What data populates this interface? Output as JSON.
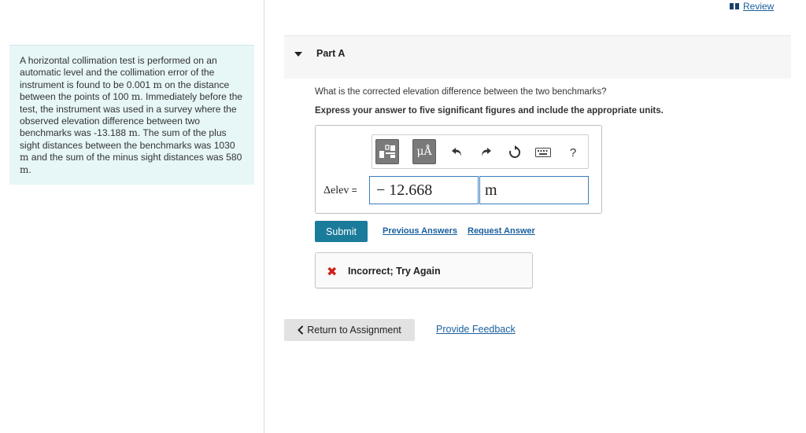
{
  "header": {
    "review_label": "Review"
  },
  "problem": {
    "s1": "A horizontal collimation test is performed on an automatic level and the collimation error of the instrument is found to be 0.001",
    "u1": "m",
    "s2": "on the distance between the points of 100",
    "u2": "m",
    "s3": ". Immediately before the test, the instrument was used in a survey where the observed elevation difference between two benchmarks was -13.188",
    "u3": "m",
    "s4": ". The sum of the plus sight distances between the benchmarks was 1030",
    "u4": "m",
    "s5": "and the sum of the minus sight distances was 580",
    "u5": "m",
    "s6": "."
  },
  "part": {
    "title": "Part A"
  },
  "question": {
    "text": "What is the corrected elevation difference between the two benchmarks?",
    "instruction": "Express your answer to five significant figures and include the appropriate units."
  },
  "toolbar": {
    "units_glyph": "μÅ",
    "help_glyph": "?"
  },
  "answer": {
    "label": "Δelev",
    "equals": " =",
    "value": "− 12.668",
    "unit": "m"
  },
  "actions": {
    "submit_label": "Submit",
    "previous_answers_label": "Previous Answers",
    "request_answer_label": "Request Answer"
  },
  "feedback": {
    "icon_glyph": "✖",
    "message": "Incorrect; Try Again"
  },
  "footer": {
    "return_label": "Return to Assignment",
    "provide_feedback_label": "Provide Feedback"
  },
  "colors": {
    "accent": "#1a7b9a",
    "link": "#1a5f9e",
    "error": "#d0201a",
    "problem_bg": "#e7f6f7"
  }
}
